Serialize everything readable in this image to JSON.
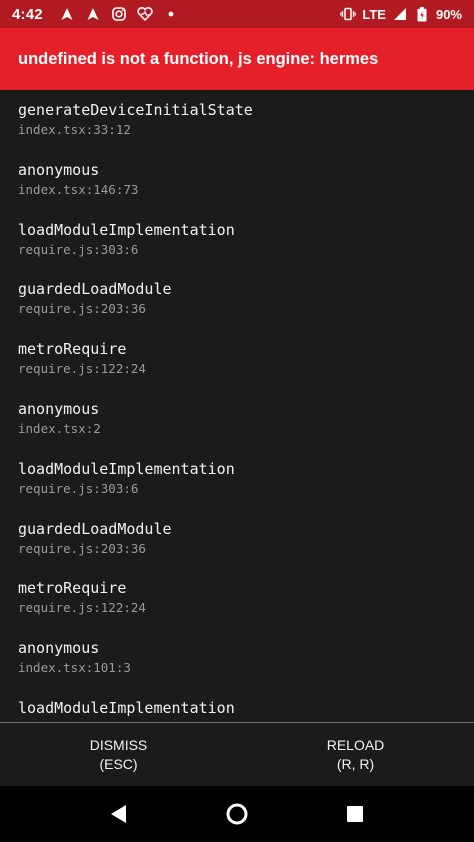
{
  "status_bar": {
    "time": "4:42",
    "network": "LTE",
    "battery": "90%",
    "icons": [
      "navigation-icon",
      "navigation-icon",
      "instagram-icon",
      "heart-app-icon",
      "dot-icon",
      "vibrate-icon",
      "signal-icon",
      "battery-icon"
    ]
  },
  "error": {
    "title": "undefined is not a function, js engine: hermes"
  },
  "stack": [
    {
      "method": "generateDeviceInitialState",
      "location": "index.tsx:33:12"
    },
    {
      "method": "anonymous",
      "location": "index.tsx:146:73"
    },
    {
      "method": "loadModuleImplementation",
      "location": "require.js:303:6"
    },
    {
      "method": "guardedLoadModule",
      "location": "require.js:203:36"
    },
    {
      "method": "metroRequire",
      "location": "require.js:122:24"
    },
    {
      "method": "anonymous",
      "location": "index.tsx:2"
    },
    {
      "method": "loadModuleImplementation",
      "location": "require.js:303:6"
    },
    {
      "method": "guardedLoadModule",
      "location": "require.js:203:36"
    },
    {
      "method": "metroRequire",
      "location": "require.js:122:24"
    },
    {
      "method": "anonymous",
      "location": "index.tsx:101:3"
    },
    {
      "method": "loadModuleImplementation",
      "location": ""
    }
  ],
  "footer": {
    "dismiss_label": "DISMISS",
    "dismiss_shortcut": "(ESC)",
    "reload_label": "RELOAD",
    "reload_shortcut": "(R, R)"
  },
  "colors": {
    "status_bar": "#b21a22",
    "error_header": "#e5202a",
    "background": "#1b1b1b"
  }
}
